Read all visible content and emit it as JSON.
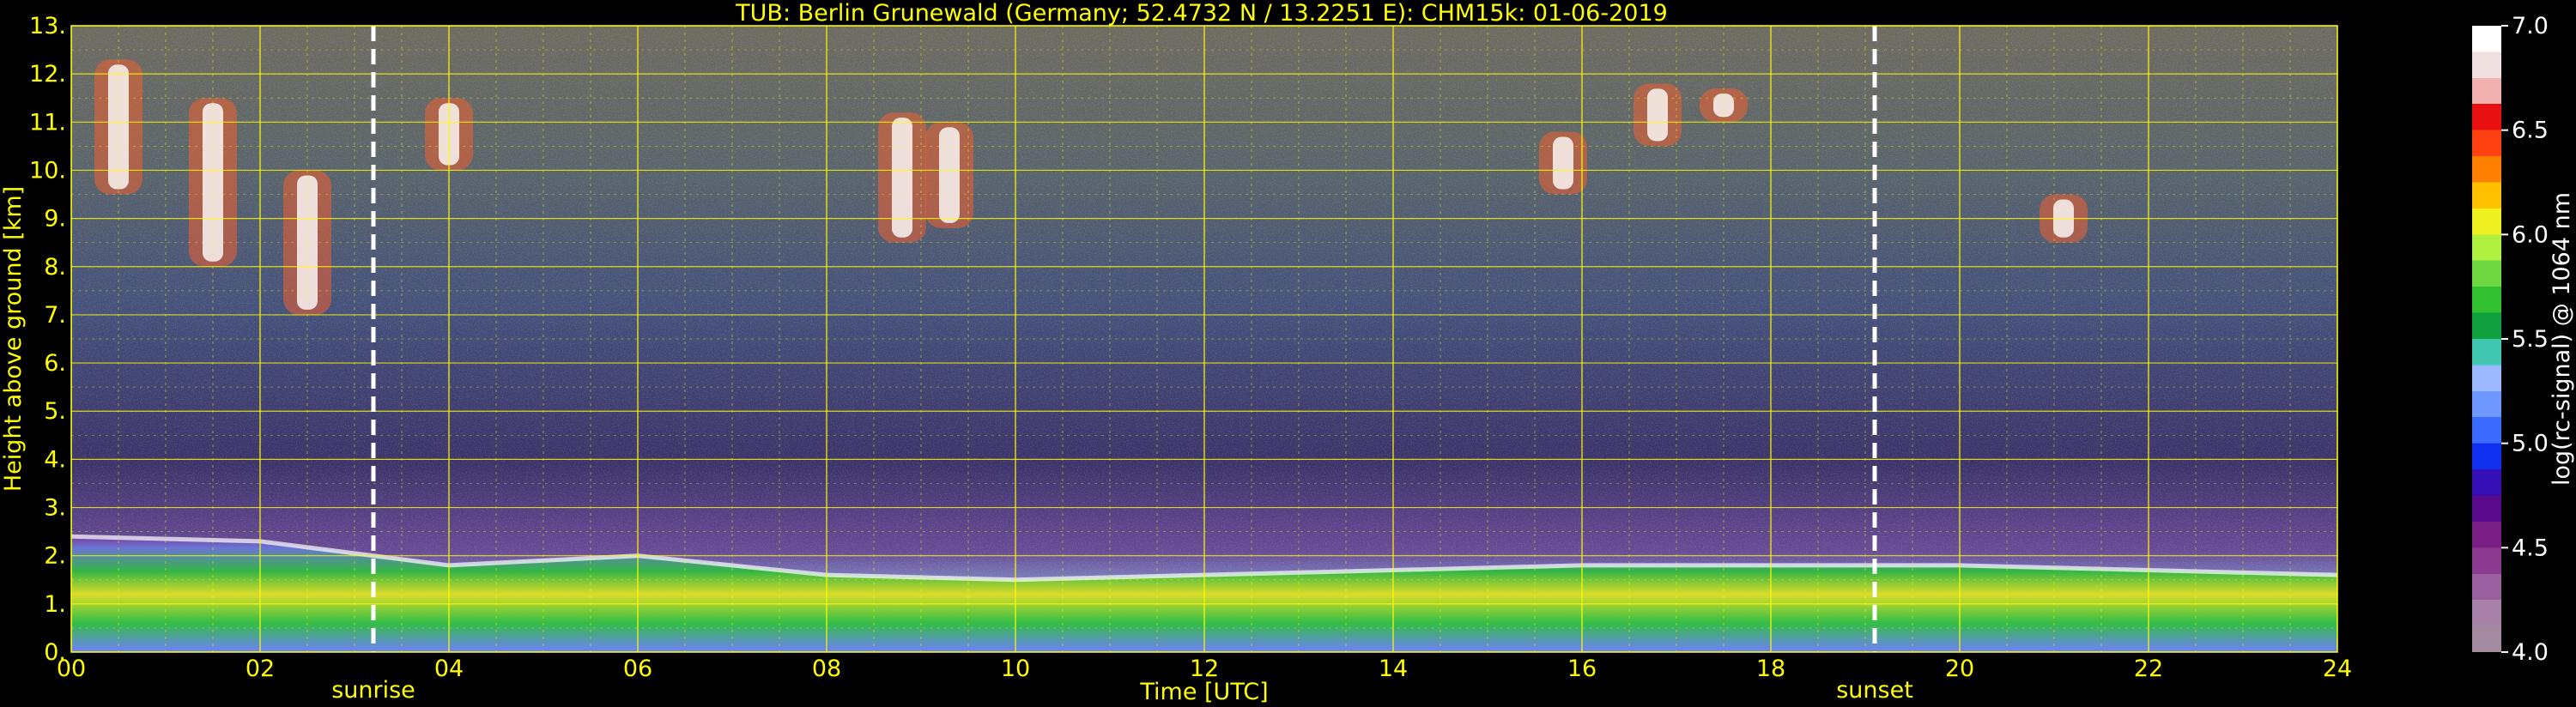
{
  "chart_data": {
    "type": "heatmap",
    "title": "TUB: Berlin Grunewald (Germany; 52.4732 N / 13.2251 E):    CHM15k: 01-06-2019",
    "xlabel": "Time [UTC]",
    "ylabel": "Height above ground [km]",
    "xlim": [
      0,
      24
    ],
    "ylim": [
      0,
      13
    ],
    "x_ticks": [
      "00",
      "02",
      "04",
      "06",
      "08",
      "10",
      "12",
      "14",
      "16",
      "18",
      "20",
      "22",
      "24"
    ],
    "y_ticks": [
      "0.",
      "1.",
      "2.",
      "3.",
      "4.",
      "5.",
      "6.",
      "7.",
      "8.",
      "9.",
      "10.",
      "11.",
      "12.",
      "13."
    ],
    "grid": true,
    "grid_color": "#ffff00",
    "markers": [
      {
        "label": "sunrise",
        "x": 3.2
      },
      {
        "label": "sunset",
        "x": 19.1
      }
    ],
    "colorbar": {
      "label": "log(rc-signal) @ 1064 nm",
      "range": [
        4.0,
        7.0
      ],
      "ticks": [
        "4.0",
        "4.5",
        "5.0",
        "5.5",
        "6.0",
        "6.5",
        "7.0"
      ],
      "colors": [
        "#a48aa0",
        "#a980a8",
        "#9a5f9e",
        "#8c3c90",
        "#7a1f86",
        "#5a0a8c",
        "#3410b4",
        "#1030f0",
        "#3c6cff",
        "#6e98ff",
        "#9cb8ff",
        "#40c8b0",
        "#10a040",
        "#30c030",
        "#70d840",
        "#b0f040",
        "#f0f020",
        "#ffc000",
        "#ff8000",
        "#ff4010",
        "#e81010",
        "#f0b0b0",
        "#f0e0e0",
        "#ffffff"
      ]
    },
    "layers": [
      {
        "feature": "boundary_layer",
        "x": [
          0,
          2,
          4,
          6,
          8,
          10,
          12,
          14,
          16,
          18,
          20,
          22,
          24
        ],
        "top_km": [
          2.4,
          2.3,
          1.8,
          2.0,
          1.6,
          1.5,
          1.6,
          1.7,
          1.8,
          1.8,
          1.8,
          1.7,
          1.6
        ]
      },
      {
        "feature": "cirrus",
        "x": [
          0.5,
          1.5,
          2.5,
          4.0,
          8.8,
          9.3,
          15.8,
          16.8,
          17.5,
          21.1
        ],
        "base_km": [
          9.5,
          8.0,
          7.0,
          10.0,
          8.5,
          8.8,
          9.5,
          10.5,
          11.0,
          8.5
        ],
        "top_km": [
          12.3,
          11.5,
          10.0,
          11.5,
          11.2,
          11.0,
          10.8,
          11.8,
          11.7,
          9.5
        ]
      }
    ]
  }
}
